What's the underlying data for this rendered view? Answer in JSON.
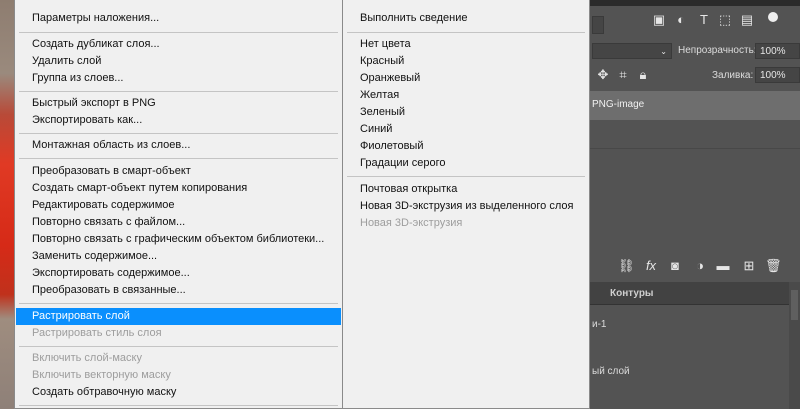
{
  "left_menu": {
    "items": [
      {
        "label": "Параметры наложения...",
        "disabled": false
      },
      {
        "label": "Создать дубликат слоя...",
        "disabled": false
      },
      {
        "label": "Удалить слой",
        "disabled": false
      },
      {
        "label": "Группа из слоев...",
        "disabled": false
      },
      {
        "label": "Быстрый экспорт в PNG",
        "disabled": false
      },
      {
        "label": "Экспортировать как...",
        "disabled": false
      },
      {
        "label": "Монтажная область из слоев...",
        "disabled": false
      },
      {
        "label": "Преобразовать в смарт-объект",
        "disabled": false
      },
      {
        "label": "Создать смарт-объект путем копирования",
        "disabled": false
      },
      {
        "label": "Редактировать содержимое",
        "disabled": false
      },
      {
        "label": "Повторно связать с файлом...",
        "disabled": false
      },
      {
        "label": "Повторно связать с графическим объектом библиотеки...",
        "disabled": false
      },
      {
        "label": "Заменить содержимое...",
        "disabled": false
      },
      {
        "label": "Экспортировать содержимое...",
        "disabled": false
      },
      {
        "label": "Преобразовать в связанные...",
        "disabled": false
      },
      {
        "label": "Растрировать слой",
        "disabled": false,
        "highlighted": true
      },
      {
        "label": "Растрировать стиль слоя",
        "disabled": true
      },
      {
        "label": "Включить слой-маску",
        "disabled": true
      },
      {
        "label": "Включить векторную маску",
        "disabled": true
      },
      {
        "label": "Создать обтравочную маску",
        "disabled": false
      }
    ]
  },
  "right_menu": {
    "items": [
      {
        "label": "Выполнить сведение",
        "disabled": false
      },
      {
        "label": "Нет цвета",
        "disabled": false
      },
      {
        "label": "Красный",
        "disabled": false
      },
      {
        "label": "Оранжевый",
        "disabled": false
      },
      {
        "label": "Желтая",
        "disabled": false
      },
      {
        "label": "Зеленый",
        "disabled": false
      },
      {
        "label": "Синий",
        "disabled": false
      },
      {
        "label": "Фиолетовый",
        "disabled": false
      },
      {
        "label": "Градации серого",
        "disabled": false
      },
      {
        "label": "Почтовая открытка",
        "disabled": false
      },
      {
        "label": "Новая 3D-экструзия из выделенного слоя",
        "disabled": false
      },
      {
        "label": "Новая 3D-экструзия",
        "disabled": true
      }
    ]
  },
  "layers_panel": {
    "opacity_label": "Непрозрачность:",
    "opacity_value": "100%",
    "fill_label": "Заливка:",
    "fill_value": "100%",
    "layer_name_partial": "PNG-image",
    "tab_contours": "Контуры",
    "item_1_partial": "и-1",
    "item_2_partial": "ый слой"
  },
  "colors": {
    "menu_bg": "#f0f0f0",
    "highlight": "#0a8ffd",
    "panel_bg": "#535353"
  }
}
